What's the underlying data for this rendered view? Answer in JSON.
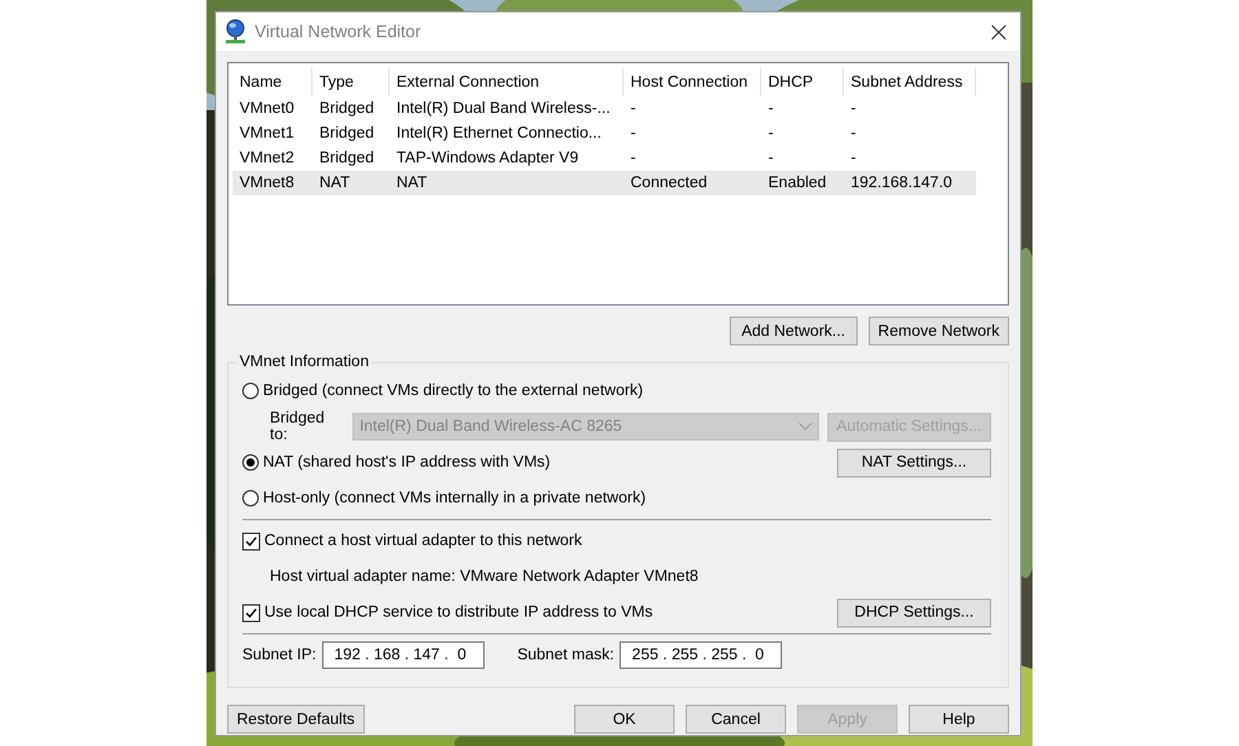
{
  "window": {
    "title": "Virtual Network Editor"
  },
  "table": {
    "columns": [
      "Name",
      "Type",
      "External Connection",
      "Host Connection",
      "DHCP",
      "Subnet Address"
    ],
    "rows": [
      {
        "cells": [
          "VMnet0",
          "Bridged",
          "Intel(R) Dual Band Wireless-...",
          "-",
          "-",
          "-"
        ],
        "selected": false
      },
      {
        "cells": [
          "VMnet1",
          "Bridged",
          "Intel(R) Ethernet Connectio...",
          "-",
          "-",
          "-"
        ],
        "selected": false
      },
      {
        "cells": [
          "VMnet2",
          "Bridged",
          "TAP-Windows Adapter V9",
          "-",
          "-",
          "-"
        ],
        "selected": false
      },
      {
        "cells": [
          "VMnet8",
          "NAT",
          "NAT",
          "Connected",
          "Enabled",
          "192.168.147.0"
        ],
        "selected": true
      }
    ]
  },
  "list_buttons": [
    {
      "label": "Add Network...",
      "disabled": false
    },
    {
      "label": "Remove Network",
      "disabled": false
    }
  ],
  "group": {
    "title": "VMnet Information",
    "modes": [
      {
        "label": "Bridged (connect VMs directly to the external network)",
        "selected": false
      },
      {
        "label": "NAT (shared host's IP address with VMs)",
        "selected": true,
        "button": {
          "label": "NAT Settings...",
          "disabled": false
        }
      },
      {
        "label": "Host-only (connect VMs internally in a private network)",
        "selected": false
      }
    ],
    "bridged_to": {
      "label": "Bridged to:",
      "value": "Intel(R) Dual Band Wireless-AC 8265",
      "disabled": true,
      "button": {
        "label": "Automatic Settings...",
        "disabled": true
      }
    },
    "adapter": {
      "label": "Connect a host virtual adapter to this network",
      "checked": true,
      "note": "Host virtual adapter name: VMware Network Adapter VMnet8"
    },
    "dhcp": {
      "label": "Use local DHCP service to distribute IP address to VMs",
      "checked": true,
      "button": {
        "label": "DHCP Settings...",
        "disabled": false
      }
    },
    "subnet_ip": {
      "label": "Subnet IP:",
      "value": "192 . 168 . 147 .  0"
    },
    "subnet_mask": {
      "label": "Subnet mask:",
      "value": "255 . 255 . 255 .  0"
    }
  },
  "footer": {
    "left": [
      {
        "label": "Restore Defaults",
        "disabled": false
      }
    ],
    "right": [
      {
        "label": "OK",
        "disabled": false
      },
      {
        "label": "Cancel",
        "disabled": false
      },
      {
        "label": "Apply",
        "disabled": true
      },
      {
        "label": "Help",
        "disabled": false
      }
    ]
  }
}
